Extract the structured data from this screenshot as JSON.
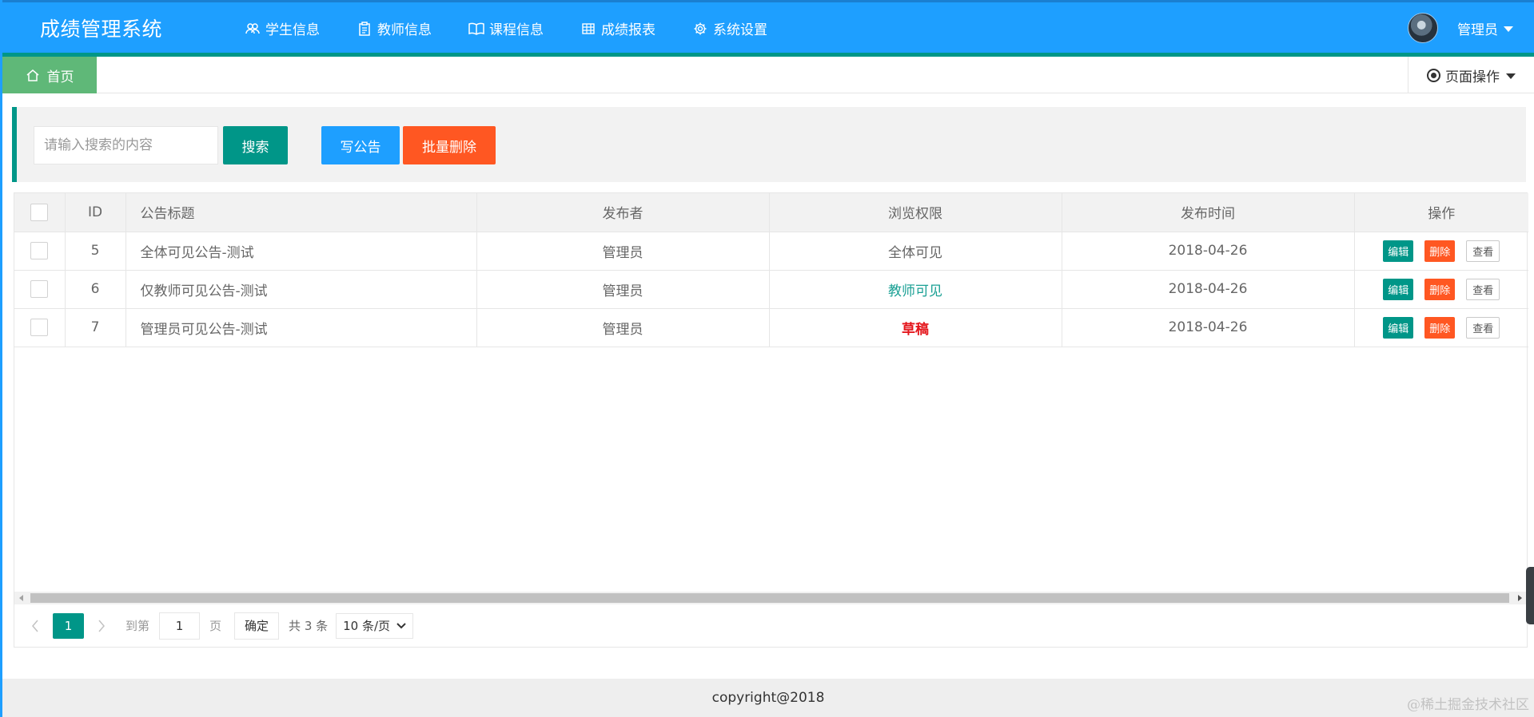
{
  "header": {
    "logo": "成绩管理系统",
    "nav": [
      {
        "label": "学生信息",
        "icon": "users-icon"
      },
      {
        "label": "教师信息",
        "icon": "clipboard-icon"
      },
      {
        "label": "课程信息",
        "icon": "book-icon"
      },
      {
        "label": "成绩报表",
        "icon": "table-grid-icon",
        "active": true
      },
      {
        "label": "系统设置",
        "icon": "gear-icon"
      }
    ],
    "user": {
      "name": "管理员"
    }
  },
  "tabs": {
    "home_label": "首页",
    "page_ops_label": "页面操作"
  },
  "toolbar": {
    "search_placeholder": "请输入搜索的内容",
    "search_label": "搜索",
    "write_notice_label": "写公告",
    "batch_delete_label": "批量删除"
  },
  "table": {
    "columns": [
      "ID",
      "公告标题",
      "发布者",
      "浏览权限",
      "发布时间",
      "操作"
    ],
    "rows": [
      {
        "id": "5",
        "title": "全体可见公告-测试",
        "publisher": "管理员",
        "permission": "全体可见",
        "date": "2018-04-26"
      },
      {
        "id": "6",
        "title": "仅教师可见公告-测试",
        "publisher": "管理员",
        "permission": "教师可见",
        "date": "2018-04-26"
      },
      {
        "id": "7",
        "title": "管理员可见公告-测试",
        "publisher": "管理员",
        "permission": "草稿",
        "date": "2018-04-26"
      }
    ],
    "actions": {
      "edit": "编辑",
      "delete": "删除",
      "view": "查看"
    }
  },
  "pager": {
    "current_page": "1",
    "goto_label": "到第",
    "goto_value": "1",
    "page_unit": "页",
    "confirm_label": "确定",
    "total": "共 3 条",
    "page_size": "10 条/页"
  },
  "footer": {
    "copyright": "copyright@2018",
    "watermark": "@稀土掘金技术社区"
  },
  "colors": {
    "header": "#1E9FFF",
    "primary_green": "#009688",
    "home_tab": "#5FB878",
    "danger": "#FF5722",
    "teacher_perm": "#1AA094",
    "draft_perm": "#e4151b"
  }
}
